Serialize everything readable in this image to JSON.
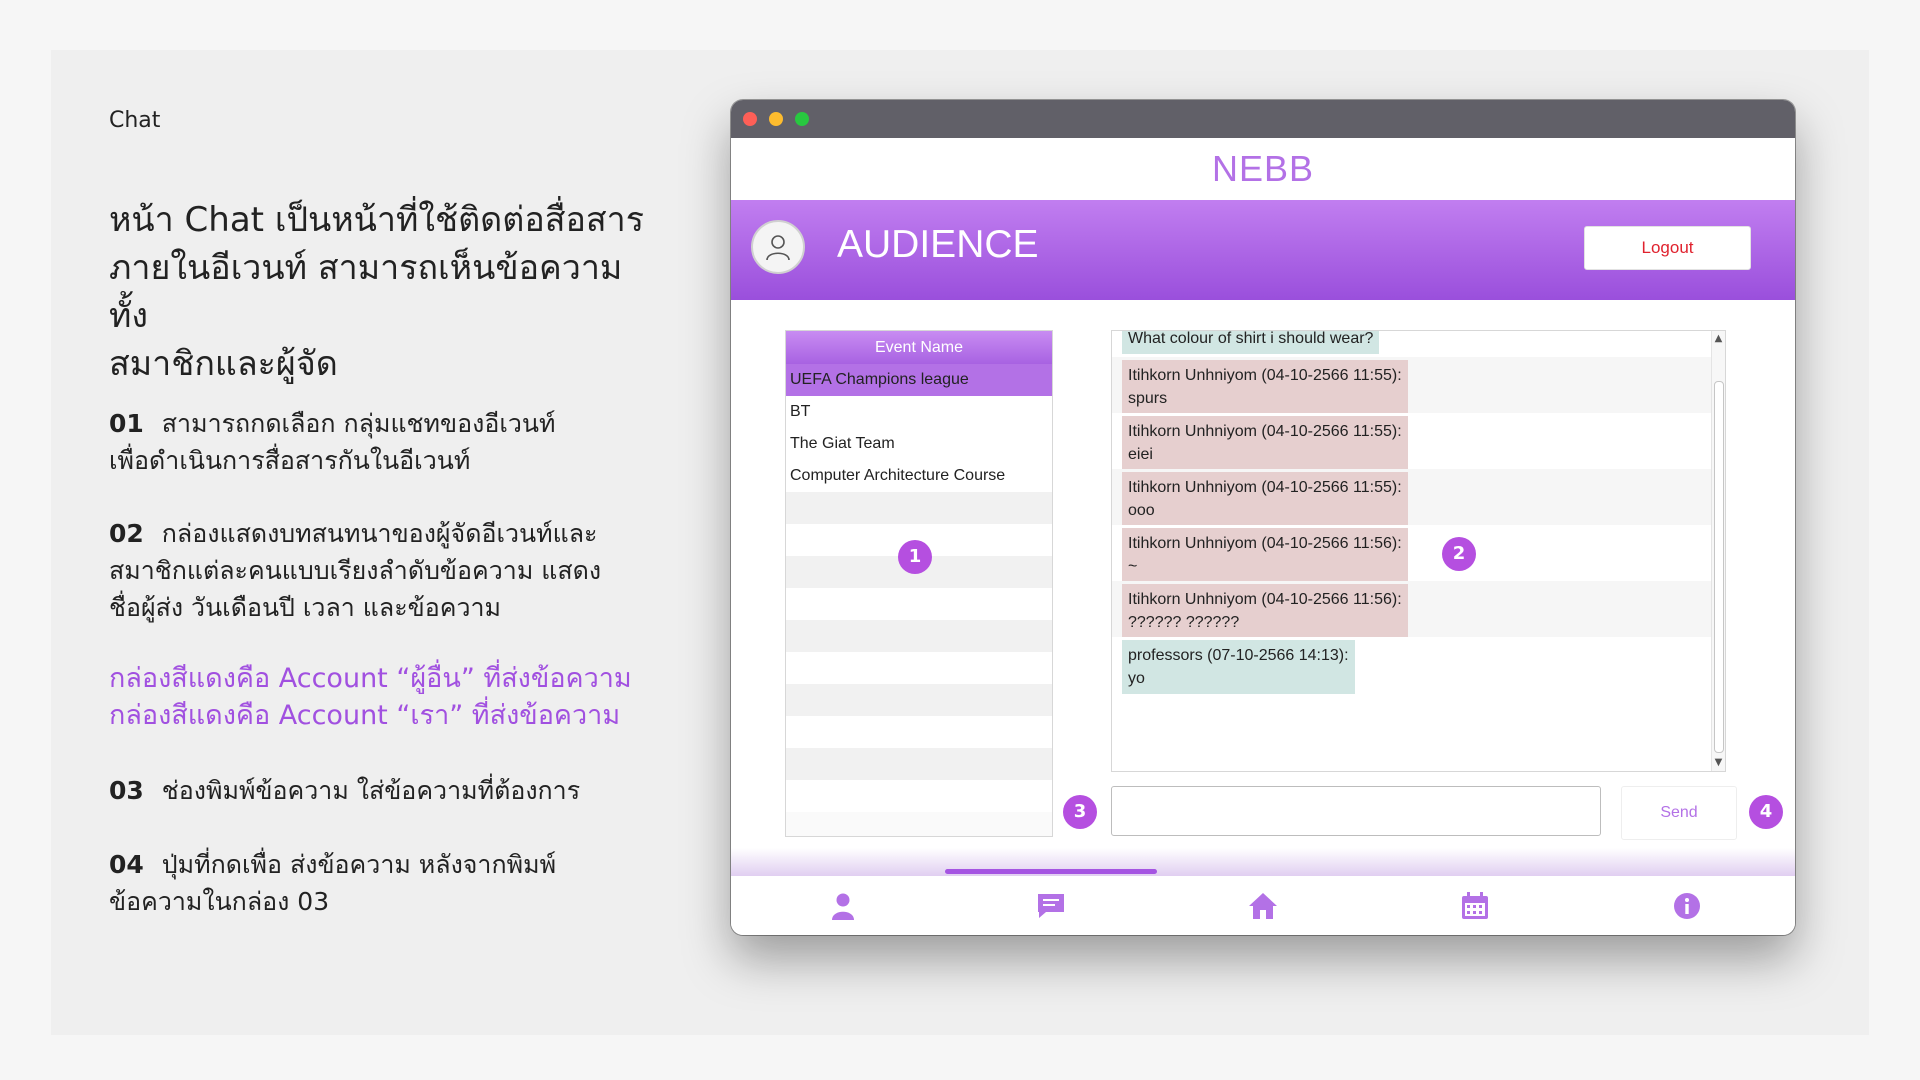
{
  "slide": {
    "section_label": "Chat",
    "headline": "หน้า Chat เป็นหน้าที่ใช้ติดต่อสื่อสาร\nภายในอีเวนท์ สามารถเห็นข้อความทั้ง\nสมาชิกและผู้จัด",
    "items": [
      {
        "num": "01",
        "text": "สามารถกดเลือก กลุ่มแชทของอีเวนท์\nเพื่อดำเนินการสื่อสารกันในอีเวนท์"
      },
      {
        "num": "02",
        "text": "กล่องแสดงบทสนทนาของผู้จัดอีเวนท์และ\nสมาชิกแต่ละคนแบบเรียงลำดับข้อความ แสดง\nชื่อผู้ส่ง วันเดือนปี เวลา และข้อความ"
      },
      {
        "num": "03",
        "text": "ช่องพิมพ์ข้อความ ใส่ข้อความที่ต้องการ"
      },
      {
        "num": "04",
        "text": "ปุ่มที่กดเพื่อ ส่งข้อความ หลังจากพิมพ์\nข้อความในกล่อง 03"
      }
    ],
    "legend": [
      "กล่องสีแดงคือ Account “ผู้อื่น” ที่ส่งข้อความ",
      "กล่องสีแดงคือ Account “เรา” ที่ส่งข้อความ"
    ]
  },
  "app": {
    "title": "NEBB",
    "role": "AUDIENCE",
    "logout_label": "Logout",
    "event_list": {
      "header": "Event Name",
      "events": [
        "UEFA Champions league",
        "BT",
        "The Giat Team",
        "Computer Architecture Course"
      ],
      "selected_index": 0
    },
    "chat": {
      "messages": [
        {
          "text": "What colour of shirt i should wear?",
          "from": "mine"
        },
        {
          "text": "Itihkorn Unhniyom (04-10-2566 11:55):\nspurs",
          "from": "other"
        },
        {
          "text": "Itihkorn Unhniyom (04-10-2566 11:55):\neiei",
          "from": "other"
        },
        {
          "text": "Itihkorn Unhniyom (04-10-2566 11:55):\nooo",
          "from": "other"
        },
        {
          "text": "Itihkorn Unhniyom (04-10-2566 11:56):\n~",
          "from": "other"
        },
        {
          "text": "Itihkorn Unhniyom (04-10-2566 11:56):\n?????? ??????",
          "from": "other"
        },
        {
          "text": "professors (07-10-2566 14:13):\nyo",
          "from": "mine"
        }
      ]
    },
    "input": {
      "value": "",
      "placeholder": ""
    },
    "send_label": "Send",
    "markers": [
      "1",
      "2",
      "3",
      "4"
    ],
    "nav": [
      {
        "icon": "user-icon"
      },
      {
        "icon": "chat-icon",
        "active": true
      },
      {
        "icon": "home-icon"
      },
      {
        "icon": "calendar-icon"
      },
      {
        "icon": "info-icon"
      }
    ],
    "colors": {
      "accent": "#b371e6",
      "header_gradient_top": "#c17ef0",
      "header_gradient_bottom": "#9a4fdc",
      "other_bubble": "#e6cfcf",
      "mine_bubble": "#d1e6e3",
      "logout_text": "#e0222e",
      "marker": "#b54fe0"
    }
  }
}
